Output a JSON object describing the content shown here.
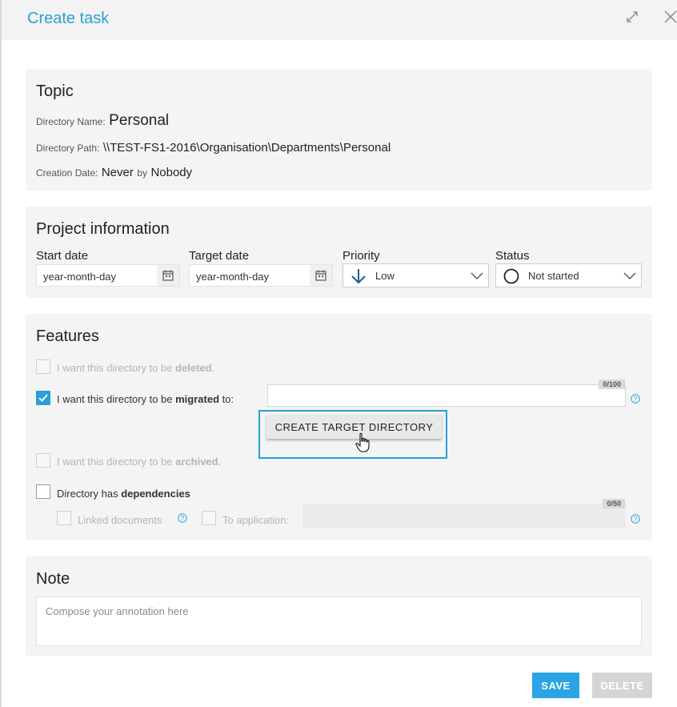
{
  "dialog": {
    "title": "Create task"
  },
  "topic": {
    "heading": "Topic",
    "name_label": "Directory Name:",
    "name_value": "Personal",
    "path_label": "Directory Path:",
    "path_value": "\\\\TEST-FS1-2016\\Organisation\\Departments\\Personal",
    "date_label": "Creation Date:",
    "date_value": "Never",
    "by_label": "by",
    "by_value": "Nobody"
  },
  "project": {
    "heading": "Project information",
    "start_label": "Start date",
    "start_value": "year-month-day",
    "target_label": "Target date",
    "target_value": "year-month-day",
    "priority_label": "Priority",
    "priority_value": "Low",
    "status_label": "Status",
    "status_value": "Not started"
  },
  "features": {
    "heading": "Features",
    "deleted": {
      "prefix": "I want this directory to be ",
      "bold": "deleted",
      "suffix": ".",
      "checked": false,
      "enabled": false
    },
    "migrated": {
      "prefix": "I want this directory to be ",
      "bold": "migrated",
      "suffix": " to:",
      "checked": true,
      "enabled": true,
      "counter": "0/100"
    },
    "create_target_button": "CREATE TARGET DIRECTORY",
    "archived": {
      "prefix": "I want this directory to be ",
      "bold": "archived",
      "suffix": ".",
      "checked": false,
      "enabled": false
    },
    "dependencies": {
      "prefix": "Directory has ",
      "bold": "dependencies",
      "checked": false,
      "enabled": true
    },
    "linked_documents": "Linked documents",
    "to_application": "To application:",
    "application_counter": "0/50"
  },
  "note": {
    "heading": "Note",
    "placeholder": "Compose your annotation here"
  },
  "buttons": {
    "save": "SAVE",
    "delete": "DELETE"
  },
  "colors": {
    "accent": "#2a9fd8",
    "save_bg": "#2aa4e4",
    "delete_bg": "#d5d5d5",
    "card_bg": "#f4f4f4"
  }
}
